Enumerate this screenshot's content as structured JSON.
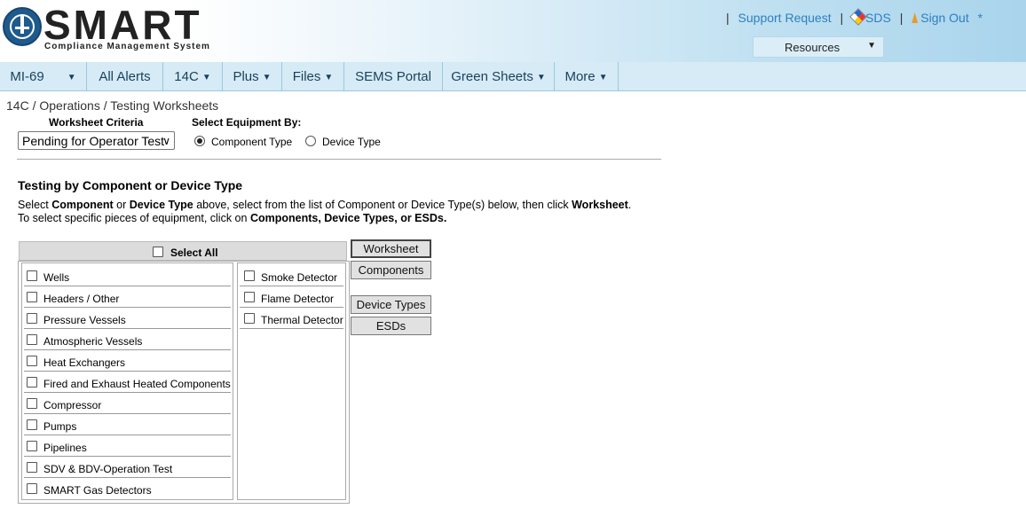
{
  "header": {
    "logo_text": "SMART",
    "logo_subtitle": "Compliance Management System",
    "links": [
      {
        "label": "Support Request"
      },
      {
        "label": "SDS",
        "icon": "sds-diamond-icon"
      },
      {
        "label": "Sign Out",
        "icon": "signout-icon"
      }
    ],
    "star": "*",
    "resources_label": "Resources"
  },
  "nav": {
    "items": [
      {
        "label": "MI-69",
        "dropdown": true
      },
      {
        "label": "All Alerts",
        "dropdown": false
      },
      {
        "label": "14C",
        "dropdown": true
      },
      {
        "label": "Plus",
        "dropdown": true
      },
      {
        "label": "Files",
        "dropdown": true
      },
      {
        "label": "SEMS Portal",
        "dropdown": false
      },
      {
        "label": "Green Sheets",
        "dropdown": true
      },
      {
        "label": "More",
        "dropdown": true
      }
    ]
  },
  "breadcrumb": "14C / Operations / Testing Worksheets",
  "criteria": {
    "label": "Worksheet Criteria",
    "selected": "Pending for Operator Test"
  },
  "equipment": {
    "label": "Select Equipment By:",
    "options": [
      {
        "label": "Component Type",
        "checked": true
      },
      {
        "label": "Device Type",
        "checked": false
      }
    ]
  },
  "section": {
    "title": "Testing by Component or Device Type",
    "instructions_line1": {
      "t1": "Select ",
      "b1": "Component",
      "t2": " or ",
      "b2": "Device Type",
      "t3": " above, select from the list of Component or Device Type(s) below, then click ",
      "b3": "Worksheet",
      "t4": "."
    },
    "instructions_line2": {
      "t1": "To select specific pieces of equipment, click on ",
      "b1": "Components, Device Types, or ESDs."
    }
  },
  "select_all_label": "Select All",
  "components": [
    "Wells",
    "Headers / Other",
    "Pressure Vessels",
    "Atmospheric Vessels",
    "Heat Exchangers",
    "Fired and Exhaust Heated Components",
    "Compressor",
    "Pumps",
    "Pipelines",
    "SDV & BDV-Operation Test",
    "SMART Gas Detectors"
  ],
  "detectors": [
    "Smoke Detector",
    "Flame Detector",
    "Thermal Detector"
  ],
  "buttons": {
    "worksheet": "Worksheet",
    "components": "Components",
    "device_types": "Device Types",
    "esds": "ESDs"
  }
}
